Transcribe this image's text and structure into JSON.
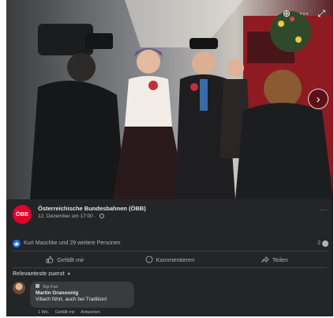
{
  "photo": {
    "tools": [
      {
        "name": "zoom-in-icon",
        "glyph": "⊕"
      },
      {
        "name": "options-icon",
        "glyph": "⋯"
      },
      {
        "name": "fullscreen-icon",
        "glyph": "⤢"
      }
    ],
    "next_glyph": "›"
  },
  "post": {
    "page_logo_text": "ÖBB",
    "page_name": "Österreichische Bundesbahnen (ÖBB)",
    "time": "12. Dezember um 17:00 ·",
    "more_glyph": "···",
    "reactions_text": "Kurt Maschke und 29 weitere Personen",
    "comment_count": "2",
    "colors": {
      "accent": "#1877f2",
      "logo": "#e2002a",
      "panel": "#242526",
      "bubble": "#3a3b3c"
    }
  },
  "actions": {
    "like": "Gefällt mir",
    "comment": "Kommentieren",
    "share": "Teilen"
  },
  "sort": {
    "label": "Relevanteste zuerst",
    "caret": "▾"
  },
  "comment": {
    "badge": "Top-Fan",
    "author": "Martin Granounig",
    "text": "Villach führt, auch bei Tradition!",
    "age": "1 Wo.",
    "like_link": "Gefällt mir",
    "reply_link": "Antworten"
  }
}
